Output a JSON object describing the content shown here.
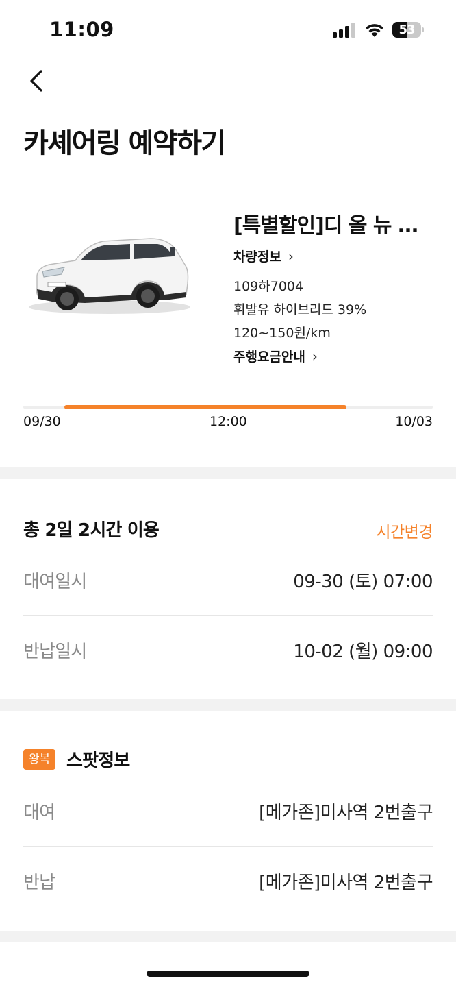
{
  "status_bar": {
    "time": "11:09",
    "battery": "53",
    "battery_level": 0.53
  },
  "header": {
    "title": "카셰어링 예약하기"
  },
  "car": {
    "name": "[특별할인]디 올 뉴 니로 하이브리드",
    "info_link": "차량정보",
    "plate": "109하7004",
    "fuel": "휘발유 하이브리드 39%",
    "rate": "120~150원/km",
    "fee_link": "주행요금안내"
  },
  "timeline": {
    "start_label": "09/30",
    "mid_label": "12:00",
    "end_label": "10/03",
    "selected_start": 0.1,
    "selected_end": 0.79,
    "accent": "#f5822a"
  },
  "rental": {
    "summary": "총 2일 2시간 이용",
    "change_label": "시간변경",
    "pickup_label": "대여일시",
    "pickup_value": "09-30 (토) 07:00",
    "return_label": "반납일시",
    "return_value": "10-02 (월) 09:00"
  },
  "spot": {
    "badge": "왕복",
    "title": "스팟정보",
    "pickup_label": "대여",
    "pickup_value": "[메가존]미사역 2번출구",
    "return_label": "반납",
    "return_value": "[메가존]미사역 2번출구"
  },
  "icons": [
    "back-arrow-icon",
    "signal-icon",
    "wifi-icon",
    "battery-icon",
    "chevron-right-icon"
  ]
}
